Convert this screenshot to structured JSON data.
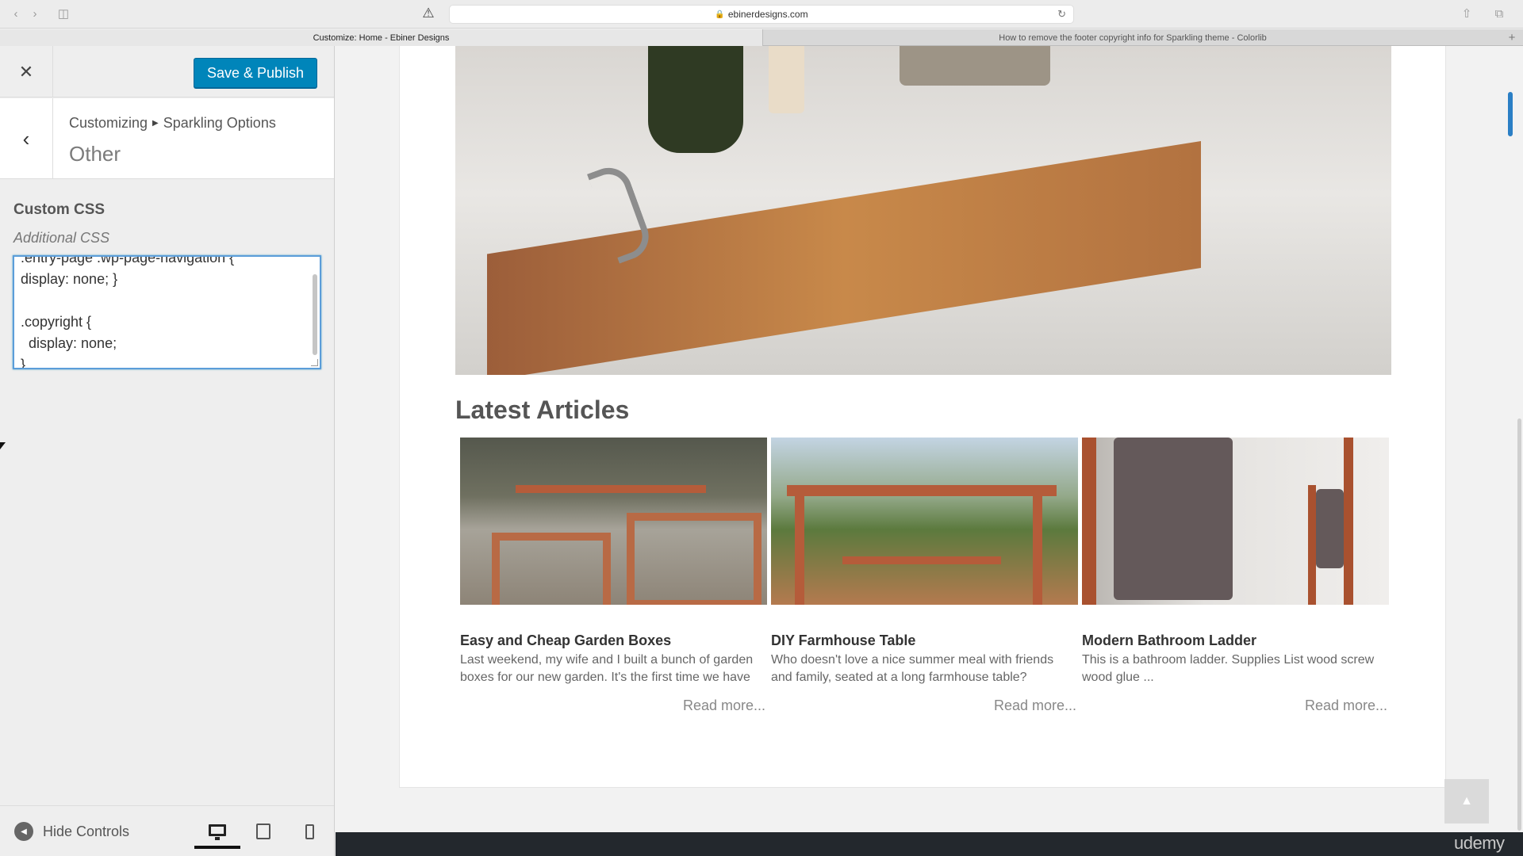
{
  "browser": {
    "url": "ebinerdesigns.com",
    "tabs": [
      {
        "label": "Customize: Home - Ebiner Designs",
        "active": true
      },
      {
        "label": "How to remove the footer copyright info for Sparkling theme - Colorlib",
        "active": false
      }
    ]
  },
  "customizer": {
    "publish_label": "Save & Publish",
    "breadcrumb": {
      "root": "Customizing",
      "section": "Sparkling Options"
    },
    "section_title": "Other",
    "control_label": "Custom CSS",
    "control_description": "Additional CSS",
    "css_text": ".entry-page .wp-page-navigation {\ndisplay: none; }\n\n.copyright {\n  display: none;\n}",
    "hide_controls_label": "Hide Controls",
    "accent_color": "#0085ba"
  },
  "preview": {
    "latest_title": "Latest Articles",
    "articles": [
      {
        "title": "Easy and Cheap Garden Boxes",
        "excerpt": "Last weekend, my wife and I built a bunch of garden boxes for our new garden. It's the first time we have",
        "read_more": "Read more..."
      },
      {
        "title": "DIY Farmhouse Table",
        "excerpt": "Who doesn't love a nice summer meal with friends and family, seated at a long farmhouse table?",
        "read_more": "Read more..."
      },
      {
        "title": "Modern Bathroom Ladder",
        "excerpt": "This is a bathroom ladder. Supplies List wood screw wood glue ...",
        "read_more": "Read more..."
      }
    ],
    "watermark": "udemy"
  },
  "icons": {
    "close": "close-icon",
    "back": "chevron-left-icon",
    "hide": "arrow-left-circle-icon",
    "desktop": "desktop-icon",
    "tablet": "tablet-icon",
    "mobile": "mobile-icon",
    "scroll_top": "chevron-up-icon"
  }
}
